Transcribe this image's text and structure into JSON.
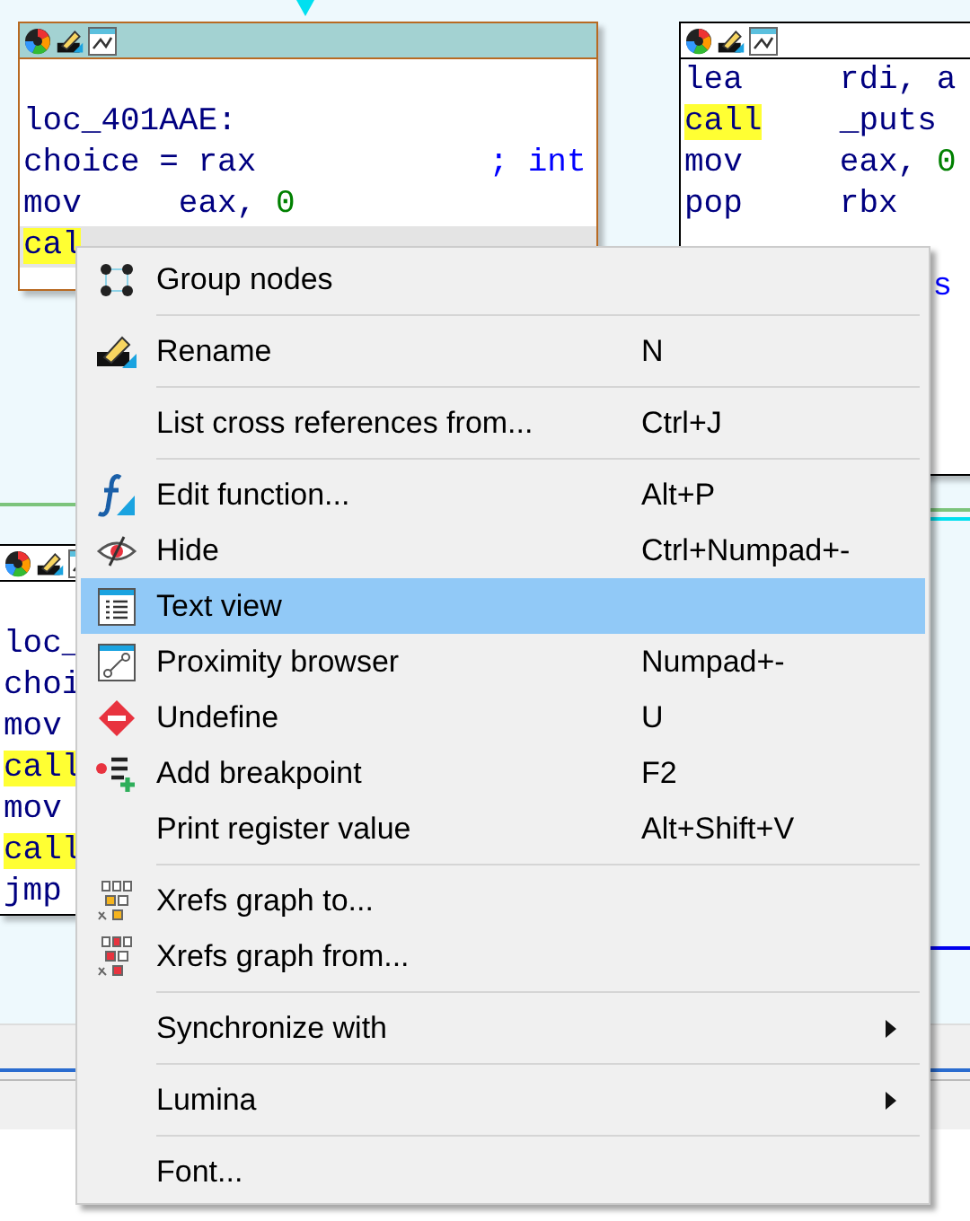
{
  "graph": {
    "blocks": [
      {
        "selected": true,
        "lines": [
          {
            "kind": "blank"
          },
          {
            "kind": "label",
            "text": "loc_401AAE:"
          },
          {
            "kind": "var",
            "text": "choice = rax",
            "comment": "; int"
          },
          {
            "kind": "insn",
            "mnemonic": "mov",
            "operand": "eax,",
            "number": "0"
          },
          {
            "kind": "insn",
            "mnemonic": "cal",
            "highlighted": true,
            "current": true
          }
        ]
      },
      {
        "selected": false,
        "lines": [
          {
            "kind": "insn",
            "mnemonic": "lea",
            "operand": "rdi, a"
          },
          {
            "kind": "insn",
            "mnemonic": "call",
            "highlighted": true,
            "operand": "_puts"
          },
          {
            "kind": "insn",
            "mnemonic": "mov",
            "operand": "eax,",
            "number": "0"
          },
          {
            "kind": "insn",
            "mnemonic": "pop",
            "operand": "rbx"
          },
          {
            "kind": "blank"
          },
          {
            "kind": "tail",
            "comment": "s"
          }
        ]
      },
      {
        "selected": false,
        "lines": [
          {
            "kind": "blank"
          },
          {
            "kind": "label",
            "text": "loc_"
          },
          {
            "kind": "var",
            "text": "choi"
          },
          {
            "kind": "insn",
            "mnemonic": "mov"
          },
          {
            "kind": "insn",
            "mnemonic": "call",
            "highlighted": true
          },
          {
            "kind": "insn",
            "mnemonic": "mov"
          },
          {
            "kind": "insn",
            "mnemonic": "call",
            "highlighted": true
          },
          {
            "kind": "insn",
            "mnemonic": "jmp"
          }
        ]
      }
    ]
  },
  "context_menu": {
    "sections": [
      [
        {
          "label": "Group nodes",
          "selected": false
        }
      ],
      [
        {
          "label": "Rename",
          "shortcut": "N",
          "selected": false
        }
      ],
      [
        {
          "label": "List cross references from...",
          "shortcut": "Ctrl+J",
          "selected": false
        }
      ],
      [
        {
          "label": "Edit function...",
          "shortcut": "Alt+P",
          "selected": false
        },
        {
          "label": "Hide",
          "shortcut": "Ctrl+Numpad+-",
          "selected": false
        },
        {
          "label": "Text view",
          "selected": true
        },
        {
          "label": "Proximity browser",
          "shortcut": "Numpad+-",
          "selected": false
        },
        {
          "label": "Undefine",
          "shortcut": "U",
          "selected": false
        },
        {
          "label": "Add breakpoint",
          "shortcut": "F2",
          "selected": false
        },
        {
          "label": "Print register value",
          "shortcut": "Alt+Shift+V",
          "selected": false
        }
      ],
      [
        {
          "label": "Xrefs graph to...",
          "selected": false
        },
        {
          "label": "Xrefs graph from...",
          "selected": false
        }
      ],
      [
        {
          "label": "Synchronize with",
          "submenu": true,
          "selected": false
        }
      ],
      [
        {
          "label": "Lumina",
          "submenu": true,
          "selected": false
        }
      ],
      [
        {
          "label": "Font...",
          "selected": false
        }
      ]
    ]
  }
}
